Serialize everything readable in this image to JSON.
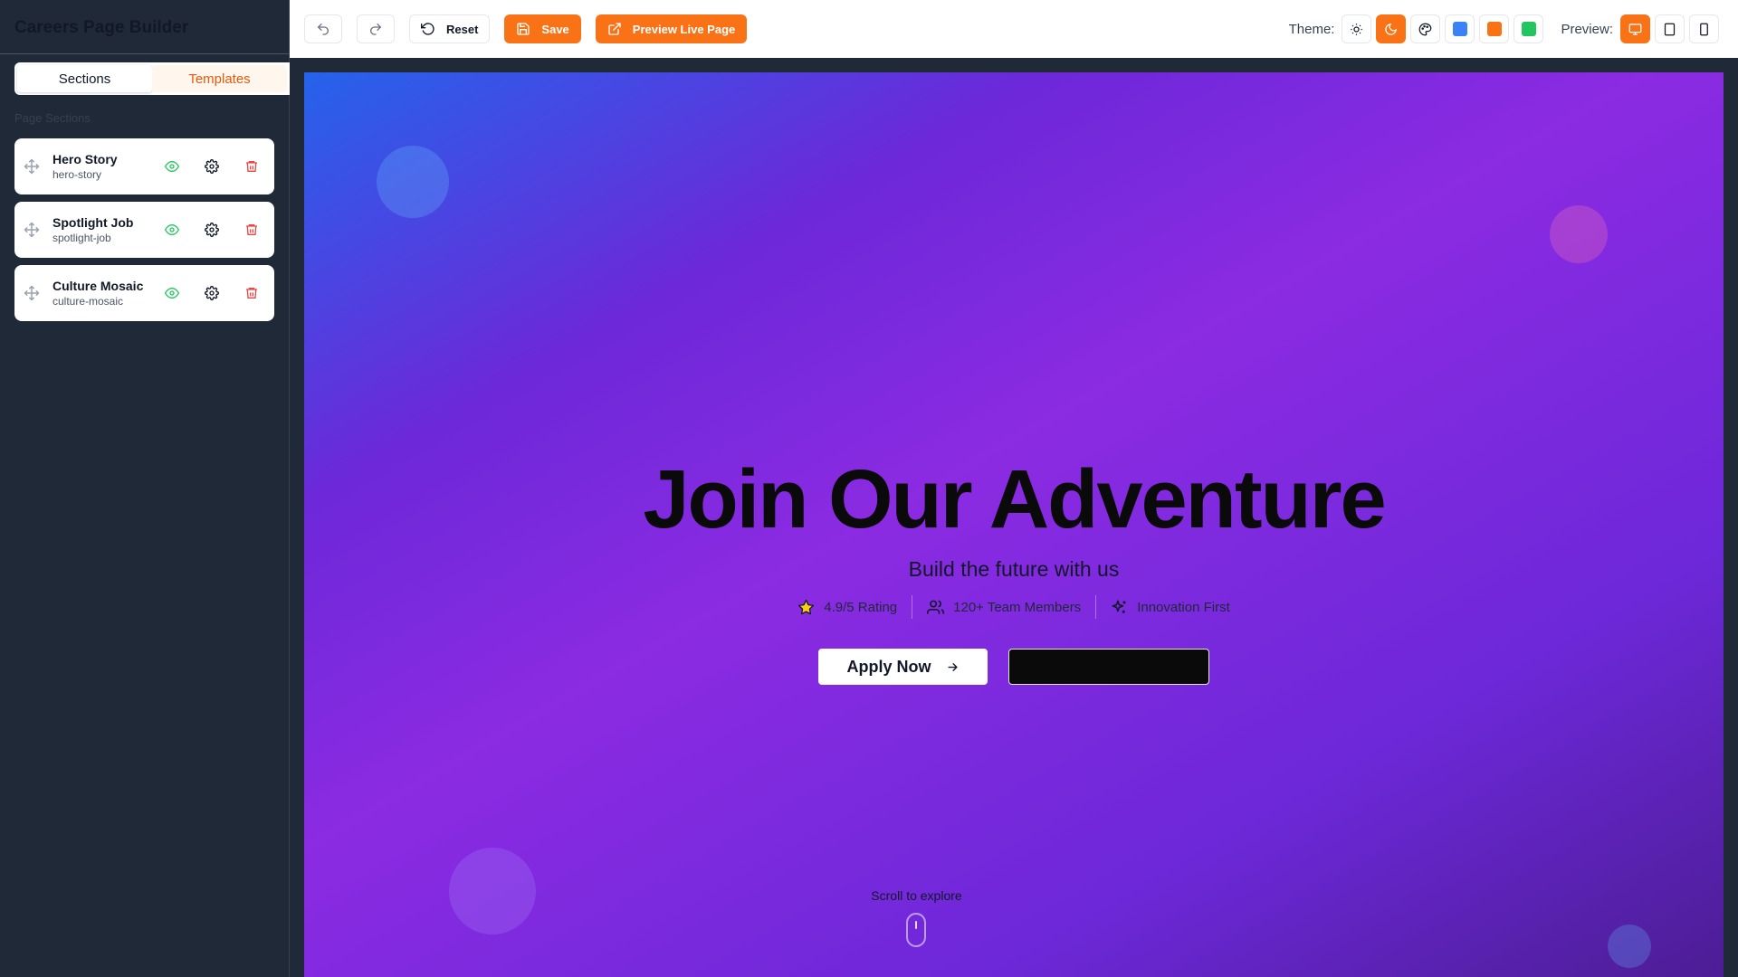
{
  "app": {
    "title": "Careers Page Builder"
  },
  "sidebar": {
    "tabs": [
      {
        "label": "Sections"
      },
      {
        "label": "Templates"
      }
    ],
    "section_label": "Page Sections",
    "sections": [
      {
        "name": "Hero Story",
        "slug": "hero-story"
      },
      {
        "name": "Spotlight Job",
        "slug": "spotlight-job"
      },
      {
        "name": "Culture Mosaic",
        "slug": "culture-mosaic"
      }
    ]
  },
  "toolbar": {
    "reset_label": "Reset",
    "save_label": "Save",
    "preview_live_label": "Preview Live Page",
    "theme_label": "Theme:",
    "preview_label": "Preview:",
    "theme_active": "dark",
    "swatches": [
      "#3b82f6",
      "#f97316",
      "#22c55e"
    ],
    "preview_active": "desktop"
  },
  "hero": {
    "title": "Join Our Adventure",
    "subtitle": "Build the future with us",
    "stats": [
      {
        "icon": "star-icon",
        "text": "4.9/5 Rating"
      },
      {
        "icon": "users-icon",
        "text": "120+ Team Members"
      },
      {
        "icon": "sparkles-icon",
        "text": "Innovation First"
      }
    ],
    "primary_cta": "Apply Now",
    "secondary_cta": "",
    "scroll_hint": "Scroll to explore"
  },
  "colors": {
    "accent": "#f97316",
    "delete": "#ef4444",
    "visible": "#22c55e"
  }
}
